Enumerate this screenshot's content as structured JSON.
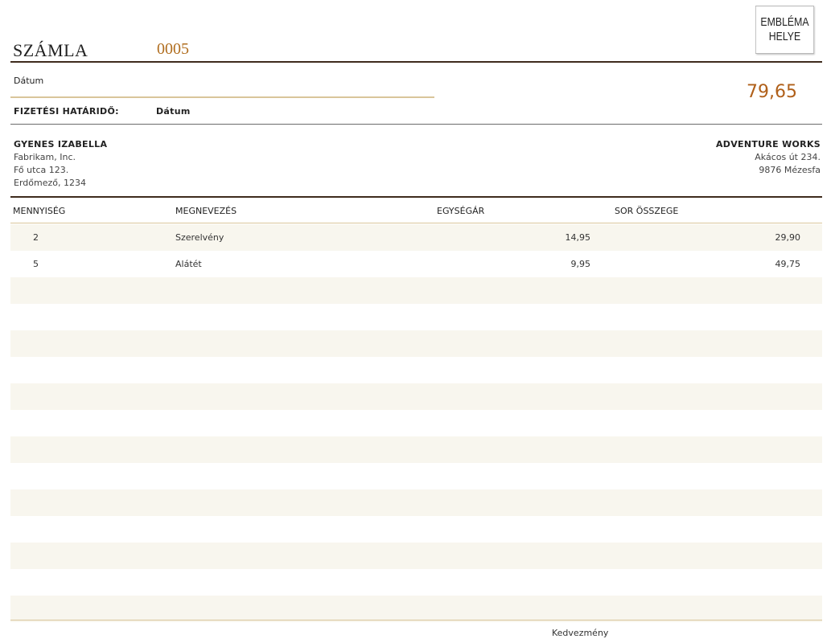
{
  "header": {
    "title": "SZÁMLA",
    "invoice_number": "0005",
    "logo_lines": [
      "EMBLÉMA",
      "HELYE"
    ]
  },
  "info": {
    "date_label": "Dátum",
    "due_label": "FIZETÉSI HATÁRIDŐ:",
    "due_value": "Dátum",
    "total": "79,65"
  },
  "bill_to": {
    "name": "GYENES IZABELLA",
    "company": "Fabrikam, Inc.",
    "street": "Fő utca 123.",
    "city": "Erdőmező, 1234"
  },
  "from": {
    "name": "ADVENTURE WORKS",
    "street": "Akácos út 234.",
    "city": "9876 Mézesfa"
  },
  "table": {
    "columns": [
      "MENNYISÉG",
      "MEGNEVEZÉS",
      "EGYSÉGÁR",
      "SOR ÖSSZEGE"
    ],
    "rows": [
      {
        "qty": "2",
        "desc": "Szerelvény",
        "unit": "14,95",
        "total": "29,90"
      },
      {
        "qty": "5",
        "desc": "Alátét",
        "unit": "9,95",
        "total": "49,75"
      },
      {
        "qty": "",
        "desc": "",
        "unit": "",
        "total": ""
      },
      {
        "qty": "",
        "desc": "",
        "unit": "",
        "total": ""
      },
      {
        "qty": "",
        "desc": "",
        "unit": "",
        "total": ""
      },
      {
        "qty": "",
        "desc": "",
        "unit": "",
        "total": ""
      },
      {
        "qty": "",
        "desc": "",
        "unit": "",
        "total": ""
      },
      {
        "qty": "",
        "desc": "",
        "unit": "",
        "total": ""
      },
      {
        "qty": "",
        "desc": "",
        "unit": "",
        "total": ""
      },
      {
        "qty": "",
        "desc": "",
        "unit": "",
        "total": ""
      },
      {
        "qty": "",
        "desc": "",
        "unit": "",
        "total": ""
      },
      {
        "qty": "",
        "desc": "",
        "unit": "",
        "total": ""
      },
      {
        "qty": "",
        "desc": "",
        "unit": "",
        "total": ""
      },
      {
        "qty": "",
        "desc": "",
        "unit": "",
        "total": ""
      },
      {
        "qty": "",
        "desc": "",
        "unit": "",
        "total": ""
      }
    ]
  },
  "footer": {
    "discount_label": "Kedvezmény"
  },
  "colors": {
    "accent": "#b06d1e",
    "rule": "#3e2b1d",
    "row_band": "#f8f6ee",
    "tan_rule": "#d9c59a"
  }
}
